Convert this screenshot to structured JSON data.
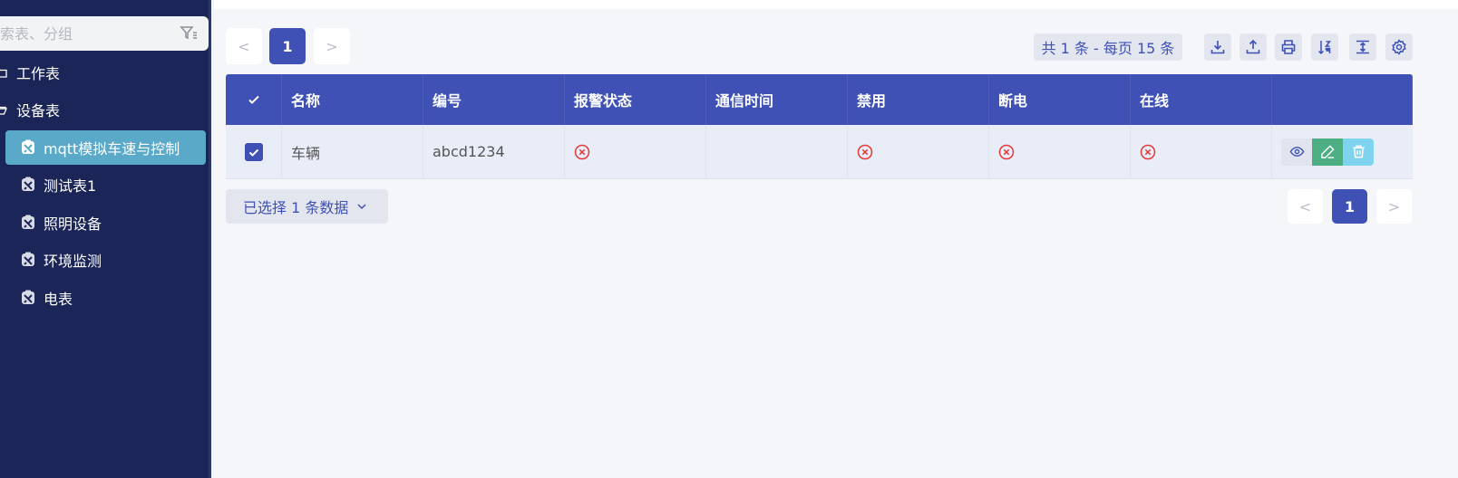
{
  "sidebar": {
    "search_placeholder": "索表、分组",
    "groups": [
      {
        "label": "工作表"
      },
      {
        "label": "设备表"
      }
    ],
    "items": [
      {
        "label": "mqtt模拟车速与控制",
        "active": true
      },
      {
        "label": "测试表1"
      },
      {
        "label": "照明设备"
      },
      {
        "label": "环境监测"
      },
      {
        "label": "电表"
      }
    ]
  },
  "pagination_top": {
    "prev": "<",
    "current": "1",
    "next": ">"
  },
  "summary": "共 1 条 - 每页 15 条",
  "toolbar_icons": [
    "download-icon",
    "upload-icon",
    "print-icon",
    "sort-icon",
    "row-height-icon",
    "settings-icon"
  ],
  "table": {
    "columns": [
      "名称",
      "编号",
      "报警状态",
      "通信时间",
      "禁用",
      "断电",
      "在线",
      ""
    ],
    "rows": [
      {
        "name": "车辆",
        "code": "abcd1234",
        "alarm": "false",
        "comm_time": "",
        "disabled": "false",
        "power_off": "false",
        "online": "false"
      }
    ]
  },
  "selected_label": "已选择 1 条数据",
  "pagination_bottom": {
    "prev": "<",
    "current": "1",
    "next": ">"
  },
  "colors": {
    "sidebar": "#1b2557",
    "primary": "#3f51b5",
    "active_item": "#5aa9c9",
    "edit": "#4cae82",
    "delete": "#7fd3ee",
    "error": "#e53935"
  }
}
